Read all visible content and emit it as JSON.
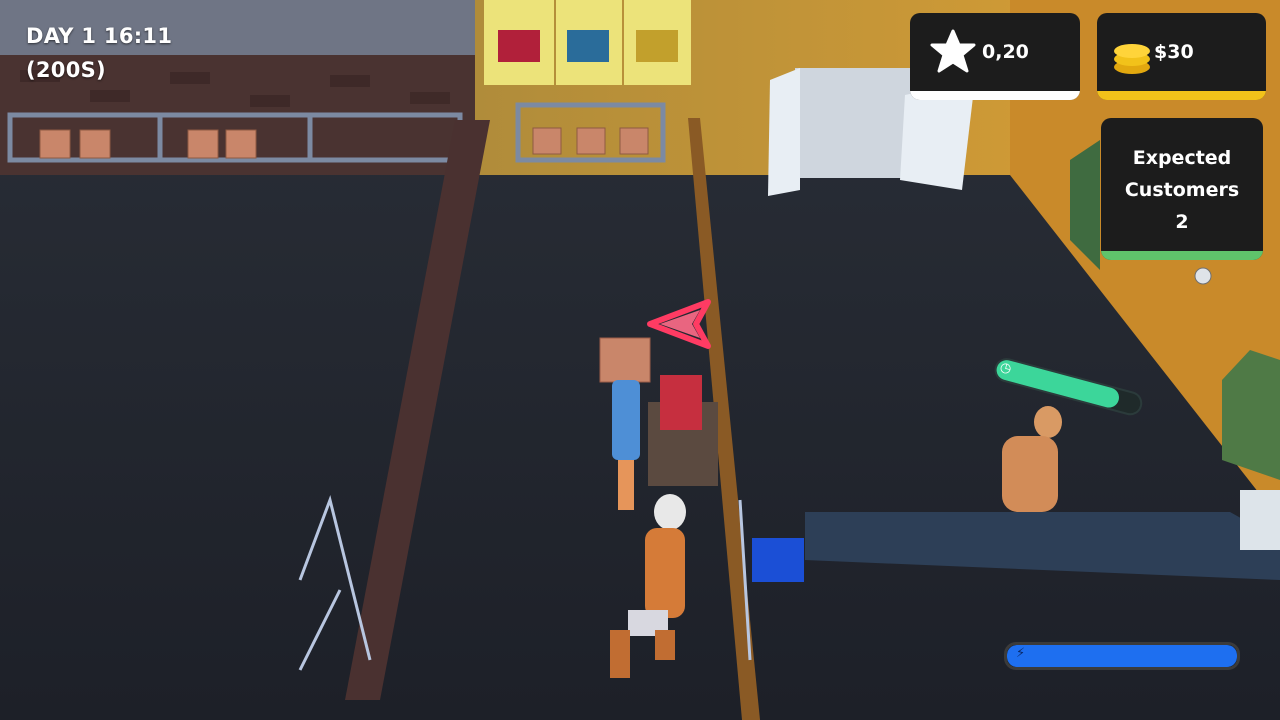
{
  "hud": {
    "day_time": "DAY 1 16:11",
    "timer": "(200S)"
  },
  "rating": {
    "icon": "star-icon",
    "value": "0,20",
    "bar_color": "#ffffff"
  },
  "money": {
    "icon": "coins-icon",
    "value": "$30",
    "bar_color": "#f2c21a"
  },
  "customers": {
    "line1": "Expected",
    "line2": "Customers",
    "count": "2",
    "bar_color": "#5fc36b"
  },
  "progress": {
    "color": "#3cd69a",
    "fill": 0.85
  },
  "energy": {
    "color": "#1e6ff0",
    "fill": 1.0
  },
  "posters": [
    "toys-box-icon",
    "tools-box-icon",
    "hardware-box-icon"
  ],
  "markers": {
    "arrow_color": "#ff3b63"
  }
}
